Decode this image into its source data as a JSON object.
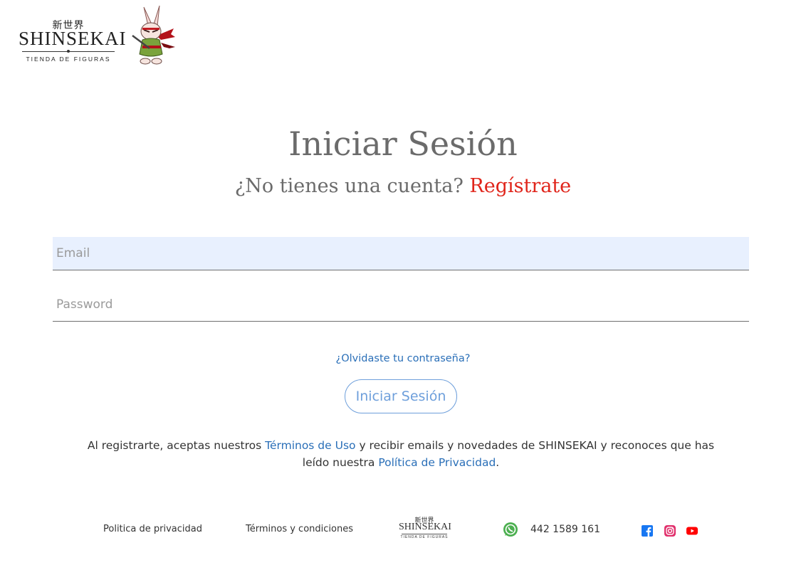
{
  "brand": {
    "kanji": "新世界",
    "name": "SHINSEKAI",
    "tagline": "TIENDA DE FIGURAS",
    "mascot": "rabbit-samurai-mascot"
  },
  "login": {
    "title": "Iniciar Sesión",
    "no_account_text": "¿No tienes una cuenta?",
    "register_link": "Regístrate",
    "email_placeholder": "Email",
    "password_placeholder": "Password",
    "forgot_link": "¿Olvidaste tu contraseña?",
    "submit_label": "Iniciar Sesión"
  },
  "legal": {
    "part1": "Al registrarte, aceptas nuestros ",
    "terms_link": "Términos de Uso",
    "part2": " y recibir emails y novedades de SHINSEKAI y reconoces que has leído nuestra ",
    "privacy_link": "Política de Privacidad",
    "part3": "."
  },
  "footer": {
    "privacy_link": "Politica de privacidad",
    "terms_link": "Términos y condiciones",
    "logo_kanji": "新世界",
    "logo_name": "SHINSEKAI",
    "logo_tagline": "TIENDA DE FIGURAS",
    "phone": "442 1589 161",
    "icons": [
      "whatsapp-icon",
      "facebook-icon",
      "instagram-icon",
      "youtube-icon"
    ]
  },
  "colors": {
    "title_gray": "#6b6b6b",
    "register_red": "#e0241a",
    "link_blue": "#2a6fb8",
    "button_blue": "#6e9fdb",
    "autofill_bg": "#e8f0fe"
  }
}
